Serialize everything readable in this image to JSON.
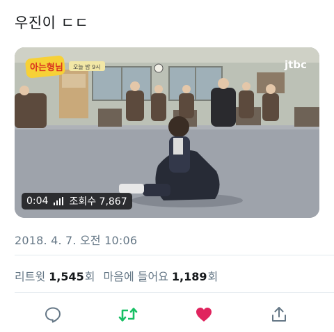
{
  "tweet": {
    "text": "우진이 ㄷㄷ"
  },
  "media": {
    "overlay_logo": "아는형님",
    "overlay_caption": "오늘 밤 9시",
    "channel_logo": "jtbc",
    "duration": "0:04",
    "views_label": "조회수 7,867",
    "icons": [
      "signal-icon"
    ]
  },
  "timestamp": "2018. 4. 7. 오전 10:06",
  "stats": {
    "retweets_label": "리트윗",
    "retweets_count": "1,545",
    "retweets_unit": "회",
    "likes_label": "마음에 들어요",
    "likes_count": "1,189",
    "likes_unit": "회"
  },
  "actions": {
    "icons": [
      "reply-icon",
      "retweet-icon",
      "like-icon",
      "share-icon"
    ],
    "colors": {
      "reply": "#657786",
      "retweet": "#17bf63",
      "like": "#e0245e",
      "share": "#657786"
    }
  }
}
